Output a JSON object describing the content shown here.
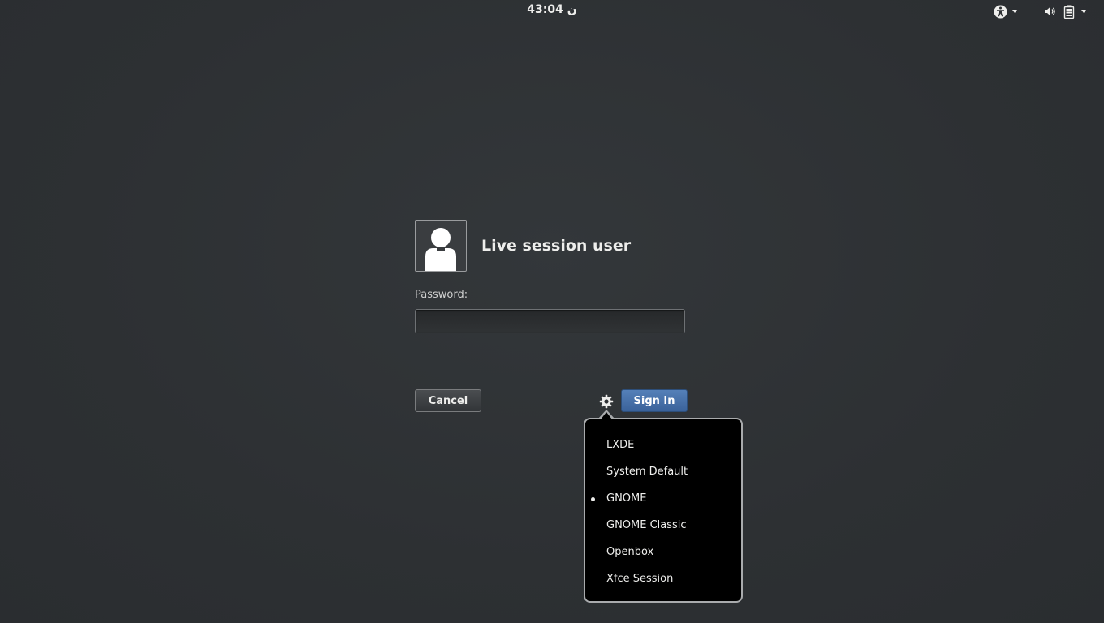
{
  "top_bar": {
    "clock": "ن 43:04",
    "icons": {
      "accessibility": "accessibility-icon",
      "volume": "volume-icon",
      "battery": "battery-icon"
    }
  },
  "login": {
    "user_name": "Live session user",
    "password_label": "Password:",
    "password_value": "",
    "cancel_label": "Cancel",
    "signin_label": "Sign In"
  },
  "session_menu": {
    "items": [
      {
        "label": "LXDE",
        "selected": false
      },
      {
        "label": "System Default",
        "selected": false
      },
      {
        "label": "GNOME",
        "selected": true
      },
      {
        "label": "GNOME Classic",
        "selected": false
      },
      {
        "label": "Openbox",
        "selected": false
      },
      {
        "label": "Xfce Session",
        "selected": false
      }
    ]
  },
  "colors": {
    "background": "#2e3134",
    "signin_button": "#4a72aa",
    "menu_background": "#000000",
    "text": "#eeeeec"
  }
}
